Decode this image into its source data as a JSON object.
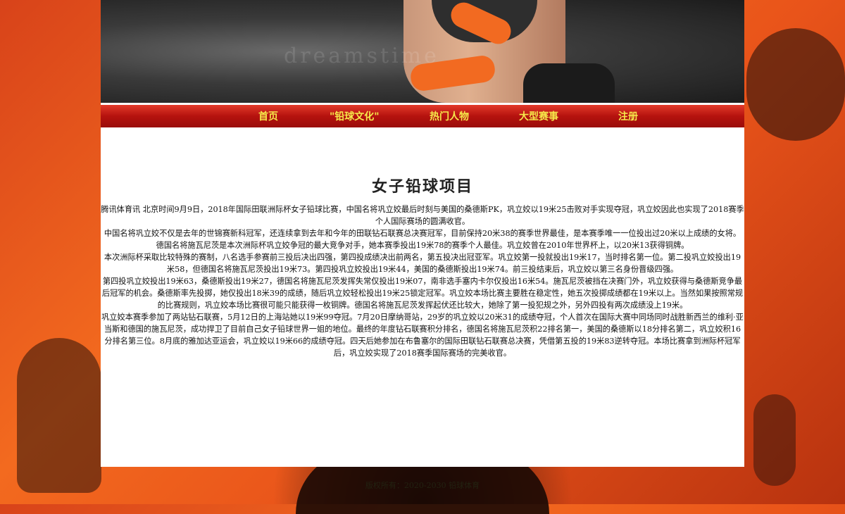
{
  "nav": {
    "items": [
      {
        "label": "首页"
      },
      {
        "label": "\"铅球文化\""
      },
      {
        "label": "热门人物"
      },
      {
        "label": "大型赛事"
      },
      {
        "label": "注册"
      }
    ]
  },
  "banner": {
    "watermark": "dreamstime"
  },
  "article": {
    "title": "女子铅球项目",
    "paragraphs": [
      "腾讯体育讯 北京时间9月9日，2018年国际田联洲际杯女子铅球比赛，中国名将巩立姣最后时刻与美国的桑德斯PK，巩立姣以19米25击败对手实现夺冠，巩立姣因此也实现了2018赛季个人国际赛场的圆满收官。",
      "中国名将巩立姣不仅是去年的世锦赛新科冠军，还连续拿到去年和今年的田联钻石联赛总决赛冠军，目前保持20米38的赛季世界最佳，是本赛季唯一一位投出过20米以上成绩的女将。德国名将施瓦尼茨是本次洲际杯巩立姣争冠的最大竞争对手，她本赛季投出19米78的赛季个人最佳。巩立姣曾在2010年世界杯上，以20米13获得铜牌。",
      "本次洲际杯采取比较特殊的赛制，八名选手参赛前三投后决出四强，第四投成绩决出前两名，第五投决出冠亚军。巩立姣第一投就投出19米17，当时排名第一位。第二投巩立姣投出19米58，但德国名将施瓦尼茨投出19米73。第四投巩立姣投出19米44，美国的桑德斯投出19米74。前三投结束后，巩立姣以第三名身份晋级四强。",
      "第四投巩立姣投出19米63，桑德斯投出19米27，德国名将施瓦尼茨发挥失常仅投出19米07，南非选手塞内卡尔仅投出16米54。施瓦尼茨被挡在决赛门外，巩立姣获得与桑德斯竞争最后冠军的机会。桑德斯率先投掷，她仅投出18米39的成绩，随后巩立姣轻松投出19米25锁定冠军。巩立姣本场比赛主要胜在稳定性，她五次投掷成绩都在19米以上。当然如果按照常规的比赛规则，巩立姣本场比赛很可能只能获得一枚铜牌。德国名将施瓦尼茨发挥起伏还比较大，她除了第一投犯规之外，另外四投有两次成绩没上19米。",
      "巩立姣本赛季参加了两站钻石联赛，5月12日的上海站她以19米99夺冠。7月20日摩纳哥站，29岁的巩立姣以20米31的成绩夺冠，个人首次在国际大赛中同场同时战胜新西兰的维利·亚当斯和德国的施瓦尼茨，成功捍卫了目前自己女子铅球世界一姐的地位。最终的年度钻石联赛积分排名，德国名将施瓦尼茨积22排名第一，美国的桑德斯以18分排名第二，巩立姣积16分排名第三位。8月底的雅加达亚运会，巩立姣以19米66的成绩夺冠。四天后她参加在布鲁塞尔的国际田联钻石联赛总决赛，凭借第五投的19米83逆转夺冠。本场比赛拿到洲际杯冠军后，巩立姣实现了2018赛季国际赛场的完美收官。"
    ]
  },
  "footer": {
    "text": "版权所有：2020-2030 铅球体育"
  }
}
